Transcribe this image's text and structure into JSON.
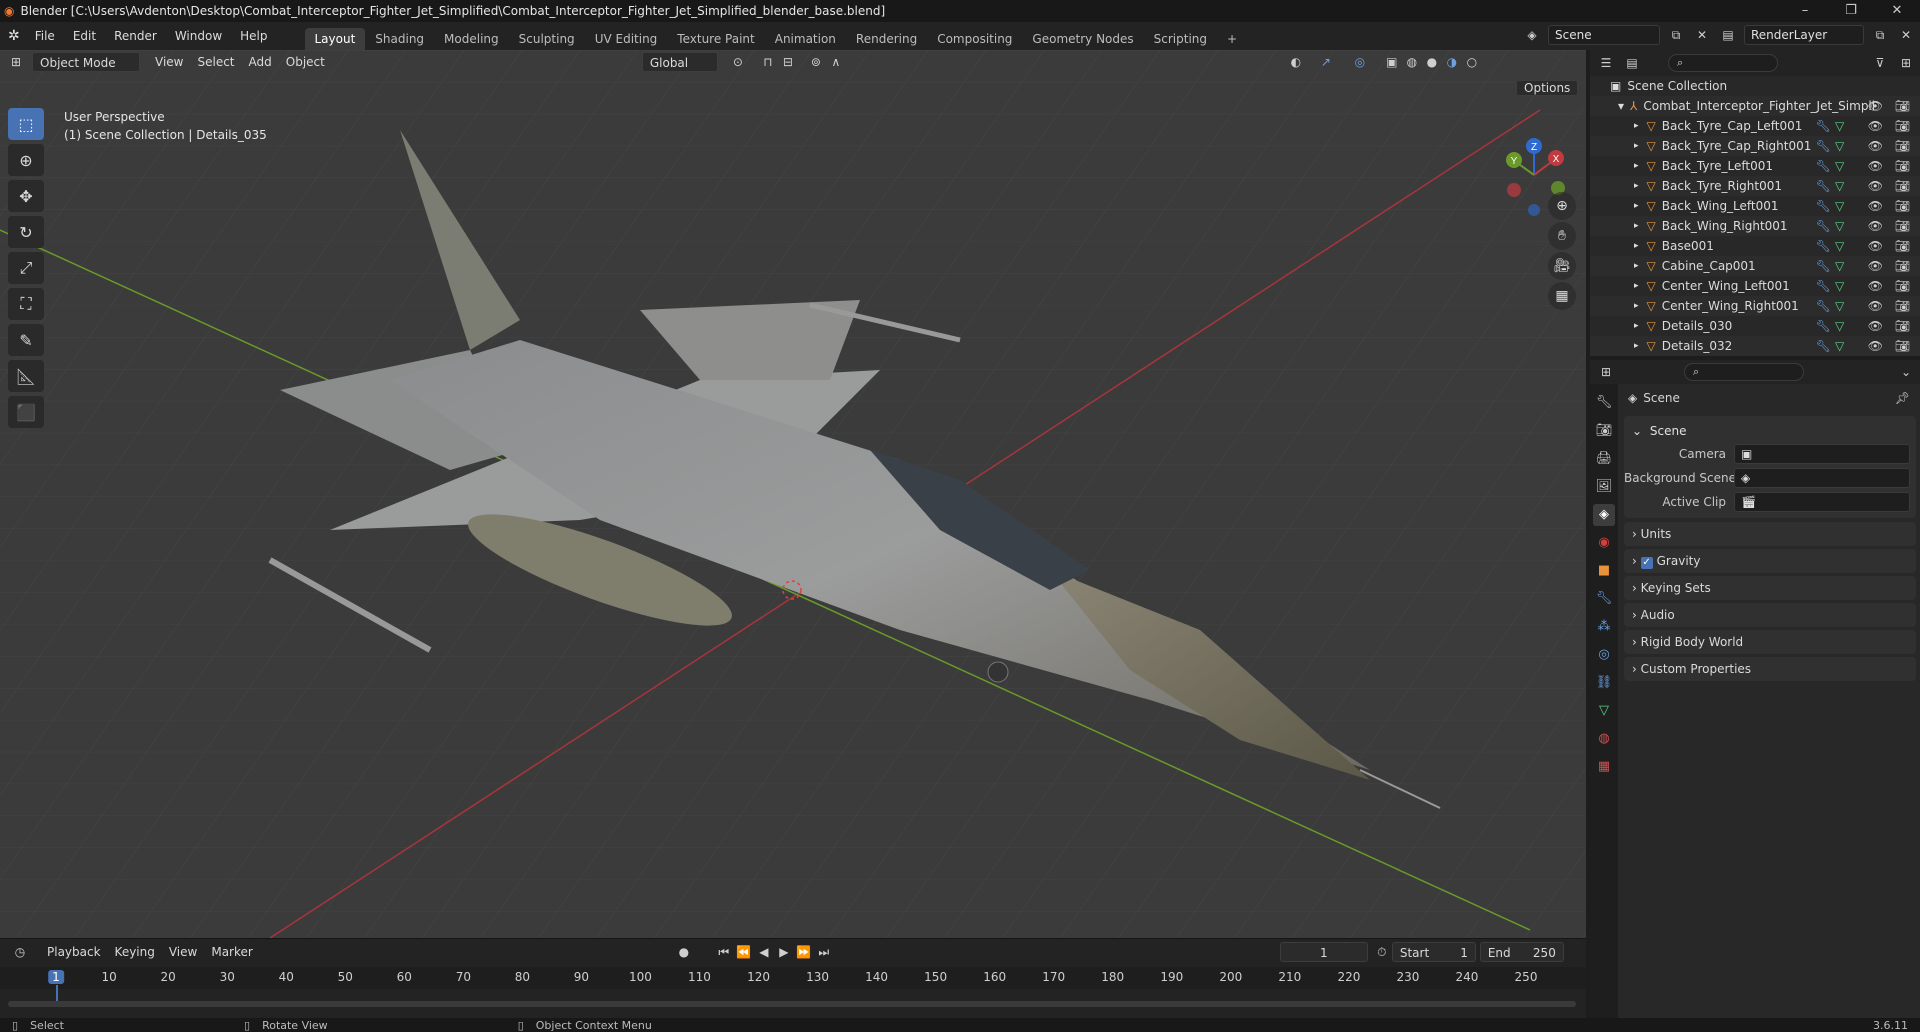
{
  "titlebar": {
    "title": "Blender [C:\\Users\\Avdenton\\Desktop\\Combat_Interceptor_Fighter_Jet_Simplified\\Combat_Interceptor_Fighter_Jet_Simplified_blender_base.blend]",
    "minimize": "–",
    "maximize": "❐",
    "close": "✕"
  },
  "menubar": {
    "menus": [
      "File",
      "Edit",
      "Render",
      "Window",
      "Help"
    ],
    "workspaces": [
      "Layout",
      "Shading",
      "Modeling",
      "Sculpting",
      "UV Editing",
      "Texture Paint",
      "Animation",
      "Rendering",
      "Compositing",
      "Geometry Nodes",
      "Scripting"
    ],
    "active_workspace": "Layout",
    "add_tab": "+",
    "scene_name": "Scene",
    "view_layer": "RenderLayer"
  },
  "viewport": {
    "mode": "Object Mode",
    "menus": [
      "View",
      "Select",
      "Add",
      "Object"
    ],
    "transform_orientation": "Global",
    "options_label": "Options",
    "overlay_line1": "User Perspective",
    "overlay_line2": "(1) Scene Collection | Details_035",
    "gizmo_axes": [
      "X",
      "Y",
      "Z"
    ],
    "colors": {
      "grid_bg": "#3b3b3b",
      "x_axis": "#a8353a",
      "y_axis": "#6a9a2a",
      "accent": "#4772b3"
    }
  },
  "toolbar": {
    "tools": [
      "select-box",
      "cursor",
      "move",
      "rotate",
      "scale",
      "transform",
      "annotate",
      "measure",
      "add-cube"
    ]
  },
  "outliner": {
    "root": "Scene Collection",
    "collection": "Combat_Interceptor_Fighter_Jet_Simplif",
    "items": [
      "Back_Tyre_Cap_Left001",
      "Back_Tyre_Cap_Right001",
      "Back_Tyre_Left001",
      "Back_Tyre_Right001",
      "Back_Wing_Left001",
      "Back_Wing_Right001",
      "Base001",
      "Cabine_Cap001",
      "Center_Wing_Left001",
      "Center_Wing_Right001",
      "Details_030",
      "Details_032"
    ]
  },
  "properties": {
    "context": "Scene",
    "panel_title": "Scene",
    "camera_label": "Camera",
    "background_scene_label": "Background Scene",
    "active_clip_label": "Active Clip",
    "collapsed_panels": [
      "Units",
      "Gravity",
      "Keying Sets",
      "Audio",
      "Rigid Body World",
      "Custom Properties"
    ],
    "gravity_checked": true
  },
  "timeline": {
    "menus": [
      "Playback",
      "Keying",
      "View",
      "Marker"
    ],
    "current_frame": "1",
    "start_label": "Start",
    "start": "1",
    "end_label": "End",
    "end": "250",
    "frame_numbers": [
      "1",
      "10",
      "20",
      "30",
      "40",
      "50",
      "60",
      "70",
      "80",
      "90",
      "100",
      "110",
      "120",
      "130",
      "140",
      "150",
      "160",
      "170",
      "180",
      "190",
      "200",
      "210",
      "220",
      "230",
      "240",
      "250"
    ]
  },
  "statusbar": {
    "select": "Select",
    "rotate_view": "Rotate View",
    "context_menu": "Object Context Menu",
    "version": "3.6.11"
  }
}
